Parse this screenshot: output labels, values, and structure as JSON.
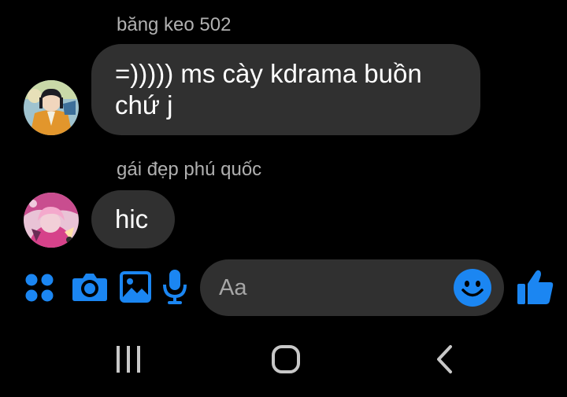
{
  "messages": [
    {
      "sender": "băng keo 502",
      "lines": [
        "=))))) ms cày kdrama buồn",
        "chứ j"
      ]
    },
    {
      "sender": "gái đẹp phú quốc",
      "lines": [
        "hic"
      ]
    }
  ],
  "composer": {
    "placeholder": "Aa",
    "icons": [
      "apps-grid-icon",
      "camera-icon",
      "image-icon",
      "microphone-icon",
      "emoji-icon",
      "thumbs-up-icon"
    ]
  },
  "nav_bar": {
    "icons": [
      "recent-apps-icon",
      "home-icon",
      "back-icon"
    ]
  },
  "colors": {
    "background": "#000000",
    "bubble": "#303030",
    "accent": "#1b86f2",
    "sender_text": "#b0b0b0",
    "nav_icons": "#c8c8c8"
  }
}
